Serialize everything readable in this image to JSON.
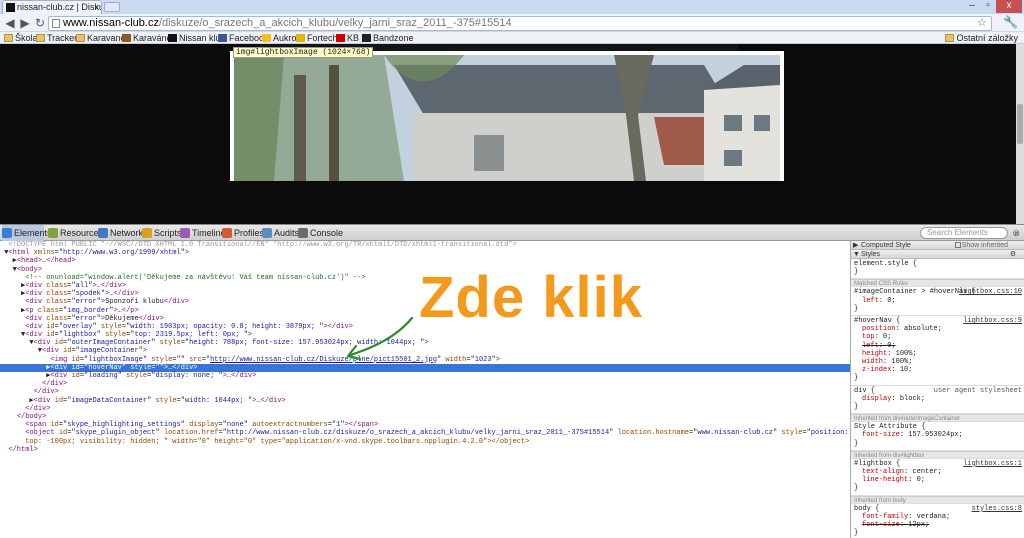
{
  "browser": {
    "tab_title": "nissan-club.cz | Diskuze | ...",
    "tab_close": "x",
    "window_controls": [
      "–",
      "▫",
      "x"
    ],
    "url_host": "www.nissan-club.cz",
    "url_path": "/diskuze/o_srazech_a_akcich_klubu/velky_jarni_sraz_2011_-375#15514",
    "bookmarks": [
      "Škola",
      "Tracker",
      "Karavanek",
      "Karavánek",
      "Nissan klub",
      "Facebook",
      "Aukro",
      "Fortech",
      "KB",
      "Bandzone"
    ],
    "other_bookmarks": "Ostatní záložky"
  },
  "page": {
    "inspect_tooltip": "img#lightboxImage (1024×768)"
  },
  "devtools": {
    "tabs": [
      "Elements",
      "Resources",
      "Network",
      "Scripts",
      "Timeline",
      "Profiles",
      "Audits",
      "Console"
    ],
    "search_placeholder": "Search Elements",
    "tab_colors": [
      "#3a7bd5",
      "#7fa33d",
      "#3f7ac0",
      "#d9a121",
      "#9a5ab8",
      "#d45a35",
      "#5a8fc2",
      "#6b6b6b"
    ],
    "dom": [
      {
        "depth": 0,
        "toggle": "",
        "doctype": "<!DOCTYPE html PUBLIC \"-//W3C//DTD XHTML 1.0 Transitional//EN\" \"http://www.w3.org/TR/xhtml1/DTD/xhtml1-transitional.dtd\">"
      },
      {
        "depth": 0,
        "toggle": "▼",
        "tag": "html",
        "attrs": [
          [
            "xmlns",
            "http://www.w3.org/1999/xhtml"
          ]
        ],
        "close": ""
      },
      {
        "depth": 1,
        "toggle": "▶",
        "tag": "head",
        "attrs": [],
        "inner": "…",
        "close": "head"
      },
      {
        "depth": 1,
        "toggle": "▼",
        "tag": "body",
        "attrs": [],
        "close": ""
      },
      {
        "depth": 2,
        "toggle": "",
        "comment": "<!-- onunload=\"window.alert('Děkujeme za návštěvu! Váš team nissan-club.cz')\" -->"
      },
      {
        "depth": 2,
        "toggle": "▶",
        "tag": "div",
        "attrs": [
          [
            "class",
            "all"
          ]
        ],
        "inner": "…",
        "close": "div"
      },
      {
        "depth": 2,
        "toggle": "▶",
        "tag": "div",
        "attrs": [
          [
            "class",
            "spodek"
          ]
        ],
        "inner": "…",
        "close": "div"
      },
      {
        "depth": 2,
        "toggle": "",
        "tag": "div",
        "attrs": [
          [
            "class",
            "error"
          ]
        ],
        "text": "Sponzoři klubu",
        "close": "div"
      },
      {
        "depth": 2,
        "toggle": "▶",
        "tag": "p",
        "attrs": [
          [
            "class",
            "img_border"
          ]
        ],
        "inner": "…",
        "close": "p"
      },
      {
        "depth": 2,
        "toggle": "",
        "tag": "div",
        "attrs": [
          [
            "class",
            "error"
          ]
        ],
        "text": "Děkujeme",
        "close": "div"
      },
      {
        "depth": 2,
        "toggle": "",
        "tag": "div",
        "attrs": [
          [
            "id",
            "overlay"
          ],
          [
            "style",
            "width: 1903px; opacity: 0.8; height: 3879px; "
          ]
        ],
        "close": "div"
      },
      {
        "depth": 2,
        "toggle": "▼",
        "tag": "div",
        "attrs": [
          [
            "id",
            "lightbox"
          ],
          [
            "style",
            "top: 2319.5px; left: 0px; "
          ]
        ],
        "close": ""
      },
      {
        "depth": 3,
        "toggle": "▼",
        "tag": "div",
        "attrs": [
          [
            "id",
            "outerImageContainer"
          ],
          [
            "style",
            "height: 788px; font-size: 157.953024px; width: 1044px; "
          ]
        ],
        "close": ""
      },
      {
        "depth": 4,
        "toggle": "▼",
        "tag": "div",
        "attrs": [
          [
            "id",
            "imageContainer"
          ]
        ],
        "close": ""
      },
      {
        "depth": 5,
        "toggle": "",
        "tag": "img",
        "attrs": [
          [
            "id",
            "lightboxImage"
          ],
          [
            "style",
            ""
          ],
          [
            "src",
            "http://www.nissan-club.cz/Diskuze/plne/pict15501_2.jpg"
          ],
          [
            "width",
            "1023"
          ]
        ],
        "close": "",
        "link_attr": "src"
      },
      {
        "depth": 5,
        "toggle": "▶",
        "tag": "div",
        "attrs": [
          [
            "id",
            "hoverNav"
          ],
          [
            "style",
            ""
          ]
        ],
        "inner": "…",
        "close": "div",
        "selected": true
      },
      {
        "depth": 5,
        "toggle": "▶",
        "tag": "div",
        "attrs": [
          [
            "id",
            "loading"
          ],
          [
            "style",
            "display: none; "
          ]
        ],
        "inner": "…",
        "close": "div"
      },
      {
        "depth": 4,
        "toggle": "",
        "endtag": "div"
      },
      {
        "depth": 3,
        "toggle": "",
        "endtag": "div"
      },
      {
        "depth": 3,
        "toggle": "▶",
        "tag": "div",
        "attrs": [
          [
            "id",
            "imageDataContainer"
          ],
          [
            "style",
            "width: 1044px; "
          ]
        ],
        "inner": "…",
        "close": "div"
      },
      {
        "depth": 2,
        "toggle": "",
        "endtag": "div"
      },
      {
        "depth": 1,
        "toggle": "",
        "endtag": "body"
      },
      {
        "depth": 2,
        "toggle": "",
        "tag": "span",
        "attrs": [
          [
            "id",
            "skype_highlighting_settings"
          ],
          [
            "display",
            "none"
          ],
          [
            "autoextractnumbers",
            "1"
          ]
        ],
        "close": "span"
      },
      {
        "depth": 2,
        "toggle": "",
        "tag": "object",
        "attrs": [
          [
            "id",
            "skype_plugin_object"
          ],
          [
            "location.href",
            "http://www.nissan-club.cz/diskuze/o_srazech_a_akcich_klubu/velky_jarni_sraz_2011_-375#15514"
          ],
          [
            "location.hostname",
            "www.nissan-club.cz"
          ],
          [
            "style",
            "position: absolute; left: -100px;"
          ]
        ],
        "close": ""
      },
      {
        "depth": 2,
        "toggle": "",
        "raw": "top: -100px; visibility: hidden; \" width=\"0\" height=\"0\" type=\"application/x-vnd.skype.toolbars.npplugin.4.2.0\"></object>"
      },
      {
        "depth": 0,
        "toggle": "",
        "endtag": "html"
      }
    ]
  },
  "sidebar": {
    "computed_style": "Computed Style",
    "show_inherited": "Show inherited",
    "styles": "Styles",
    "element_style": "element.style {",
    "matched_rules": "Matched CSS Rules",
    "rules": [
      {
        "selector": "#imageContainer > #hoverNav {",
        "source": "lightbox.css:10",
        "props": [
          {
            "n": "left",
            "v": "0",
            "strike": false
          }
        ]
      },
      {
        "selector": "#hoverNav {",
        "source": "lightbox.css:9",
        "props": [
          {
            "n": "position",
            "v": "absolute",
            "strike": false
          },
          {
            "n": "top",
            "v": "0",
            "strike": false
          },
          {
            "n": "left",
            "v": "0",
            "strike": true
          },
          {
            "n": "height",
            "v": "100%",
            "strike": false
          },
          {
            "n": "width",
            "v": "100%",
            "strike": false
          },
          {
            "n": "z-index",
            "v": "10",
            "strike": false
          }
        ]
      },
      {
        "selector": "div {",
        "source": "user agent stylesheet",
        "ua": true,
        "props": [
          {
            "n": "display",
            "v": "block",
            "strike": false
          }
        ]
      }
    ],
    "inherited": [
      {
        "label": "Inherited from div#outerImageContainer",
        "selector": "Style Attribute {",
        "source": "",
        "props": [
          {
            "n": "font-size",
            "v": "157.953024px",
            "strike": false
          }
        ]
      },
      {
        "label": "Inherited from div#lightbox",
        "selector": "#lightbox {",
        "source": "lightbox.css:1",
        "props": [
          {
            "n": "text-align",
            "v": "center",
            "strike": false
          },
          {
            "n": "line-height",
            "v": "0",
            "strike": false
          }
        ]
      },
      {
        "label": "Inherited from body",
        "selector": "body {",
        "source": "styles.css:8",
        "props": [
          {
            "n": "font-family",
            "v": "verdana",
            "strike": false
          },
          {
            "n": "font-size",
            "v": "12px",
            "strike": true
          }
        ]
      }
    ]
  },
  "annotation": {
    "text": "Zde klik",
    "color": "#f29a1b",
    "arrow_color": "#2e8b2e"
  }
}
